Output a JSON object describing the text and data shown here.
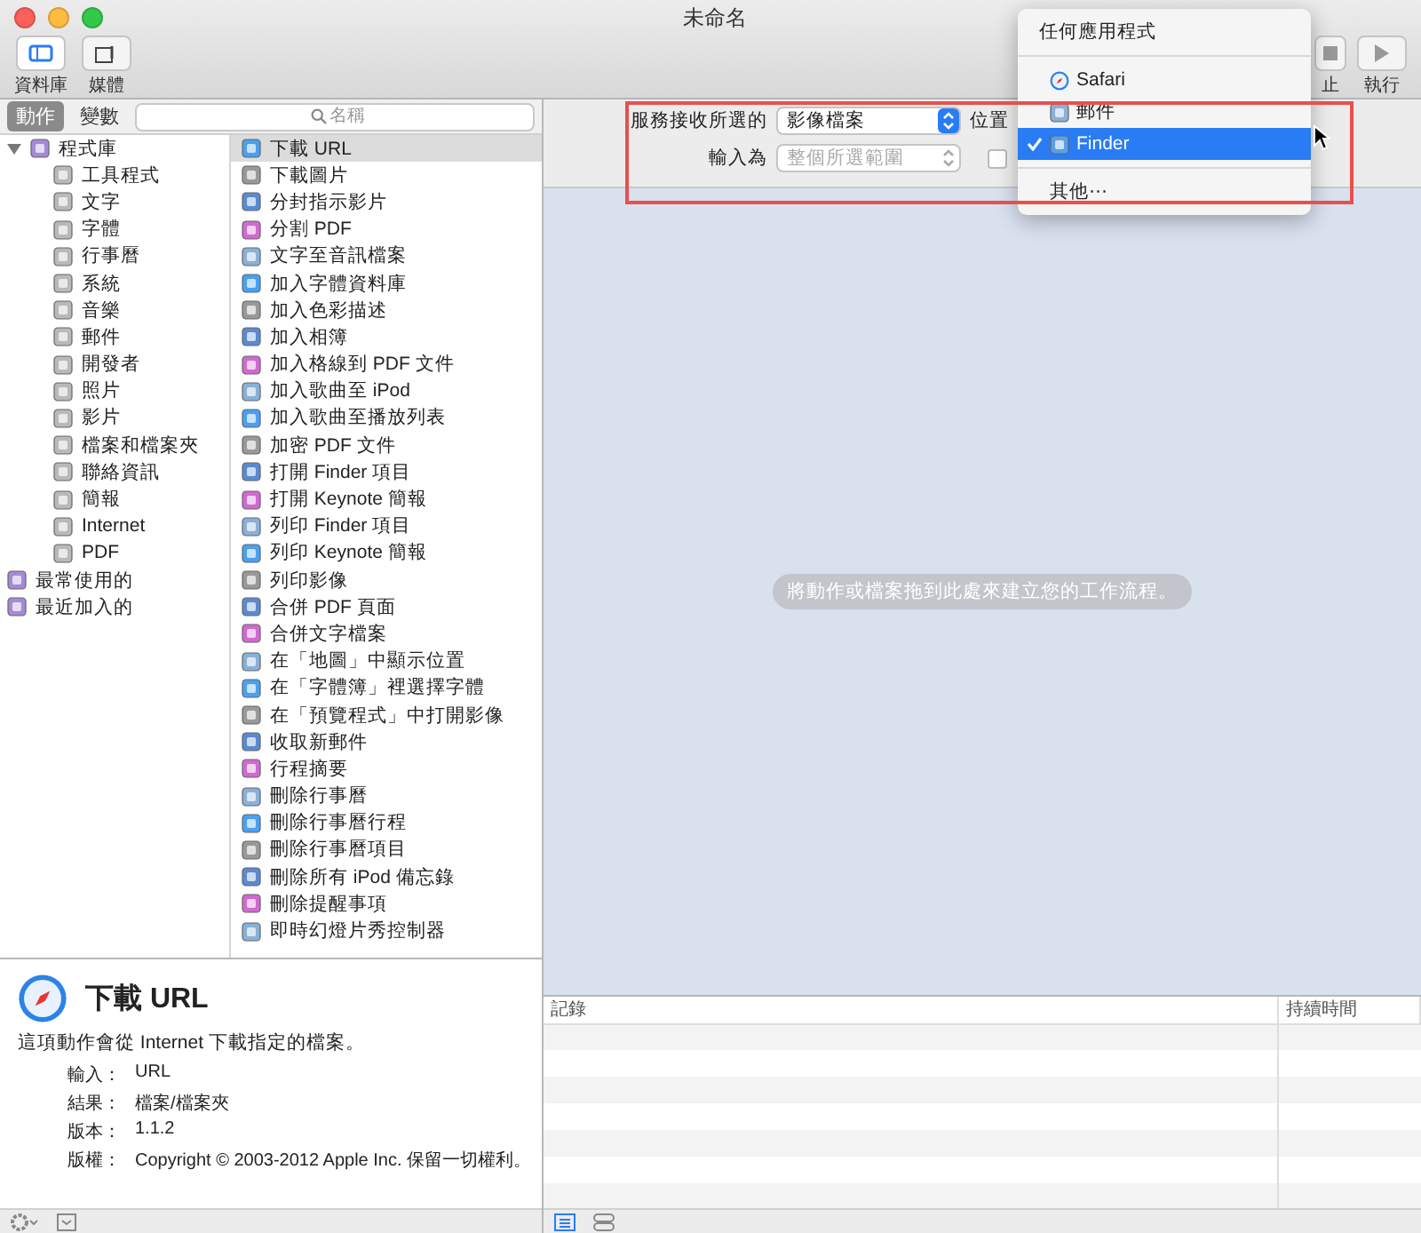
{
  "window": {
    "title": "未命名"
  },
  "toolbar": {
    "left": [
      {
        "label": "資料庫",
        "selected": true
      },
      {
        "label": "媒體",
        "selected": false
      }
    ],
    "right": [
      {
        "label": "止"
      },
      {
        "label": "執行"
      }
    ]
  },
  "pane_tabs": [
    {
      "label": "動作",
      "selected": true
    },
    {
      "label": "變數",
      "selected": false
    }
  ],
  "search": {
    "placeholder": "名稱"
  },
  "library": [
    {
      "label": "程式庫",
      "expanded": true,
      "children": [
        {
          "label": "工具程式"
        },
        {
          "label": "文字"
        },
        {
          "label": "字體"
        },
        {
          "label": "行事曆"
        },
        {
          "label": "系統"
        },
        {
          "label": "音樂"
        },
        {
          "label": "郵件"
        },
        {
          "label": "開發者"
        },
        {
          "label": "照片"
        },
        {
          "label": "影片"
        },
        {
          "label": "檔案和檔案夾"
        },
        {
          "label": "聯絡資訊"
        },
        {
          "label": "簡報"
        },
        {
          "label": "Internet"
        },
        {
          "label": "PDF"
        }
      ]
    },
    {
      "label": "最常使用的"
    },
    {
      "label": "最近加入的"
    }
  ],
  "actions": [
    {
      "label": "下載 URL",
      "selected": true
    },
    {
      "label": "下載圖片",
      "selected": false
    },
    {
      "label": "分封指示影片",
      "selected": false
    },
    {
      "label": "分割 PDF",
      "selected": false
    },
    {
      "label": "文字至音訊檔案",
      "selected": false
    },
    {
      "label": "加入字體資料庫",
      "selected": false
    },
    {
      "label": "加入色彩描述",
      "selected": false
    },
    {
      "label": "加入相簿",
      "selected": false
    },
    {
      "label": "加入格線到 PDF 文件",
      "selected": false
    },
    {
      "label": "加入歌曲至 iPod",
      "selected": false
    },
    {
      "label": "加入歌曲至播放列表",
      "selected": false
    },
    {
      "label": "加密 PDF 文件",
      "selected": false
    },
    {
      "label": "打開 Finder 項目",
      "selected": false
    },
    {
      "label": "打開 Keynote 簡報",
      "selected": false
    },
    {
      "label": "列印 Finder 項目",
      "selected": false
    },
    {
      "label": "列印 Keynote 簡報",
      "selected": false
    },
    {
      "label": "列印影像",
      "selected": false
    },
    {
      "label": "合併 PDF 頁面",
      "selected": false
    },
    {
      "label": "合併文字檔案",
      "selected": false
    },
    {
      "label": "在「地圖」中顯示位置",
      "selected": false
    },
    {
      "label": "在「字體簿」裡選擇字體",
      "selected": false
    },
    {
      "label": "在「預覽程式」中打開影像",
      "selected": false
    },
    {
      "label": "收取新郵件",
      "selected": false
    },
    {
      "label": "行程摘要",
      "selected": false
    },
    {
      "label": "刪除行事曆",
      "selected": false
    },
    {
      "label": "刪除行事曆行程",
      "selected": false
    },
    {
      "label": "刪除行事曆項目",
      "selected": false
    },
    {
      "label": "刪除所有 iPod 備忘錄",
      "selected": false
    },
    {
      "label": "刪除提醒事項",
      "selected": false
    },
    {
      "label": "即時幻燈片秀控制器",
      "selected": false
    }
  ],
  "info": {
    "title": "下載 URL",
    "description": "這項動作會從 Internet 下載指定的檔案。",
    "fields": [
      {
        "label": "輸入：",
        "value": "URL"
      },
      {
        "label": "結果：",
        "value": "檔案/檔案夾"
      },
      {
        "label": "版本：",
        "value": "1.1.2"
      },
      {
        "label": "版權：",
        "value": "Copyright © 2003-2012 Apple Inc. 保留一切權利。"
      }
    ]
  },
  "workflow_header": {
    "receives_label": "服務接收所選的",
    "receives_value": "影像檔案",
    "location_label": "位置",
    "input_label": "輸入為",
    "input_value": "整個所選範圍",
    "input_disabled": true,
    "checkbox_checked": false
  },
  "app_menu": {
    "items": [
      {
        "kind": "item",
        "label": "任何應用程式",
        "selected": false
      },
      {
        "kind": "divider"
      },
      {
        "kind": "item",
        "label": "Safari",
        "selected": false
      },
      {
        "kind": "item",
        "label": "郵件",
        "selected": false
      },
      {
        "kind": "item",
        "label": "Finder",
        "selected": true
      },
      {
        "kind": "divider"
      },
      {
        "kind": "item",
        "label": "其他⋯",
        "selected": false
      }
    ]
  },
  "workflow_hint": "將動作或檔案拖到此處來建立您的工作流程。",
  "log": {
    "columns": [
      "記錄",
      "持續時間"
    ]
  }
}
